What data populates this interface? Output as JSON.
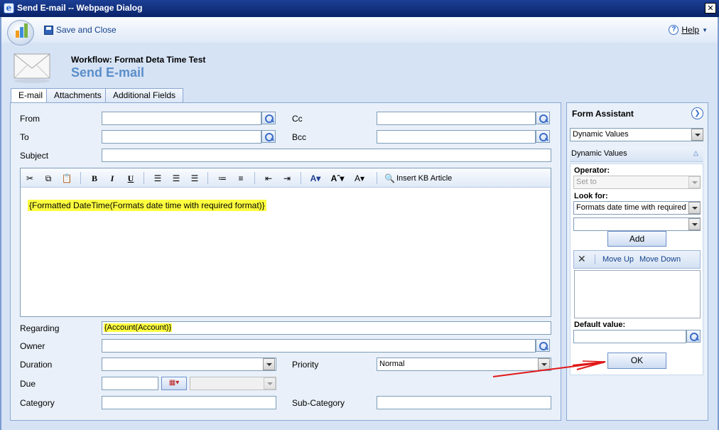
{
  "window": {
    "title": "Send E-mail -- Webpage Dialog"
  },
  "toolbar": {
    "save_close": "Save and Close",
    "help": "Help"
  },
  "header": {
    "workflow": "Workflow: Format Deta Time Test",
    "title": "Send E-mail"
  },
  "tabs": [
    {
      "label": "E-mail"
    },
    {
      "label": "Attachments"
    },
    {
      "label": "Additional Fields"
    }
  ],
  "form": {
    "from_label": "From",
    "to_label": "To",
    "cc_label": "Cc",
    "bcc_label": "Bcc",
    "subject_label": "Subject",
    "regarding_label": "Regarding",
    "regarding_value": "{Account(Account)}",
    "owner_label": "Owner",
    "duration_label": "Duration",
    "priority_label": "Priority",
    "priority_value": "Normal",
    "due_label": "Due",
    "category_label": "Category",
    "subcategory_label": "Sub-Category"
  },
  "editor": {
    "toolbar": {
      "bold": "B",
      "italic": "I",
      "underline": "U",
      "insert_kb": "Insert KB Article"
    },
    "body": "{Formatted DateTime(Formats date time with required format)}"
  },
  "assistant": {
    "title": "Form Assistant",
    "mode_value": "Dynamic Values",
    "section": "Dynamic Values",
    "operator_label": "Operator:",
    "operator_value": "Set to",
    "lookfor_label": "Look for:",
    "lookfor_value": "Formats date time with required",
    "add": "Add",
    "move_up": "Move Up",
    "move_down": "Move Down",
    "default_label": "Default value:",
    "ok": "OK"
  }
}
